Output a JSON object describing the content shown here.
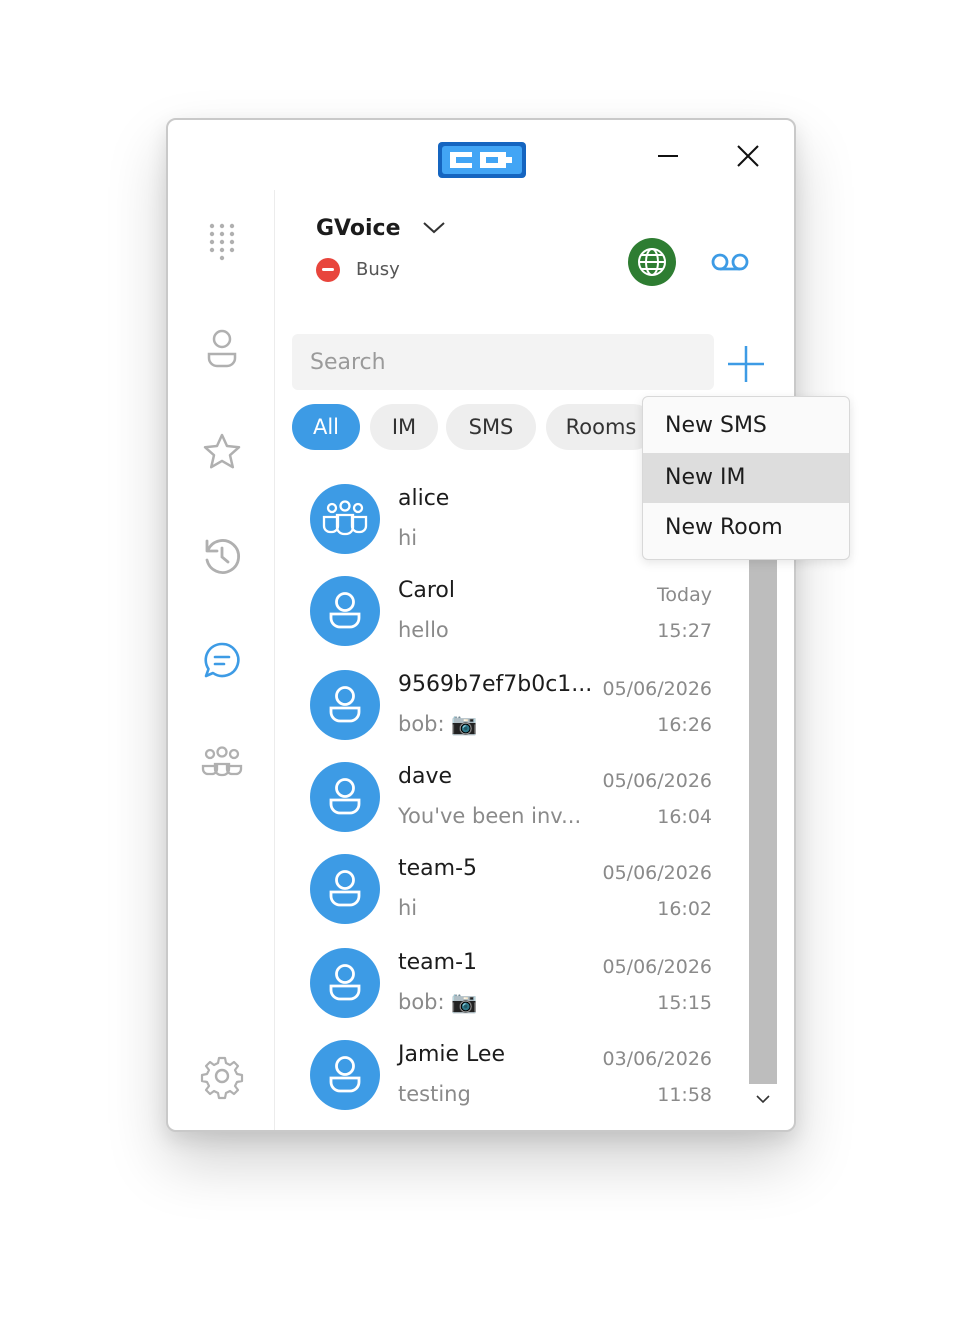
{
  "window": {
    "logo_text": "CC",
    "minimize_icon": "minimize-icon",
    "close_icon": "close-icon"
  },
  "sidebar": {
    "items": [
      {
        "name": "dialpad",
        "icon": "dialpad-icon"
      },
      {
        "name": "contacts",
        "icon": "person-icon"
      },
      {
        "name": "favorites",
        "icon": "star-icon"
      },
      {
        "name": "history",
        "icon": "history-icon"
      },
      {
        "name": "messages",
        "icon": "chat-icon",
        "active": true
      },
      {
        "name": "groups",
        "icon": "people-icon"
      },
      {
        "name": "settings",
        "icon": "gear-icon"
      }
    ]
  },
  "header": {
    "account_name": "GVoice",
    "status": "Busy",
    "status_color": "#e8453c",
    "globe_color": "#2e7d32"
  },
  "search": {
    "placeholder": "Search"
  },
  "filters": [
    {
      "label": "All",
      "active": true
    },
    {
      "label": "IM"
    },
    {
      "label": "SMS"
    },
    {
      "label": "Rooms"
    }
  ],
  "menu": {
    "items": [
      "New SMS",
      "New IM",
      "New Room"
    ],
    "hovered": "New IM"
  },
  "conversations": [
    {
      "name": "alice",
      "preview": "hi",
      "date": "",
      "time": "",
      "avatar": "group-icon"
    },
    {
      "name": "Carol",
      "preview": "hello",
      "date": "Today",
      "time": "15:27",
      "avatar": "person-icon"
    },
    {
      "name": "9569b7ef7b0c1...",
      "preview": "bob: 📷",
      "date": "05/06/2026",
      "time": "16:26",
      "avatar": "person-icon"
    },
    {
      "name": "dave",
      "preview": "You've been inv...",
      "date": "05/06/2026",
      "time": "16:04",
      "avatar": "person-icon"
    },
    {
      "name": "team-5",
      "preview": "hi",
      "date": "05/06/2026",
      "time": "16:02",
      "avatar": "person-icon"
    },
    {
      "name": "team-1",
      "preview": "bob: 📷",
      "date": "05/06/2026",
      "time": "15:15",
      "avatar": "person-icon"
    },
    {
      "name": "Jamie Lee",
      "preview": "testing",
      "date": "03/06/2026",
      "time": "11:58",
      "avatar": "person-icon"
    }
  ],
  "accent_color": "#3d9be5"
}
